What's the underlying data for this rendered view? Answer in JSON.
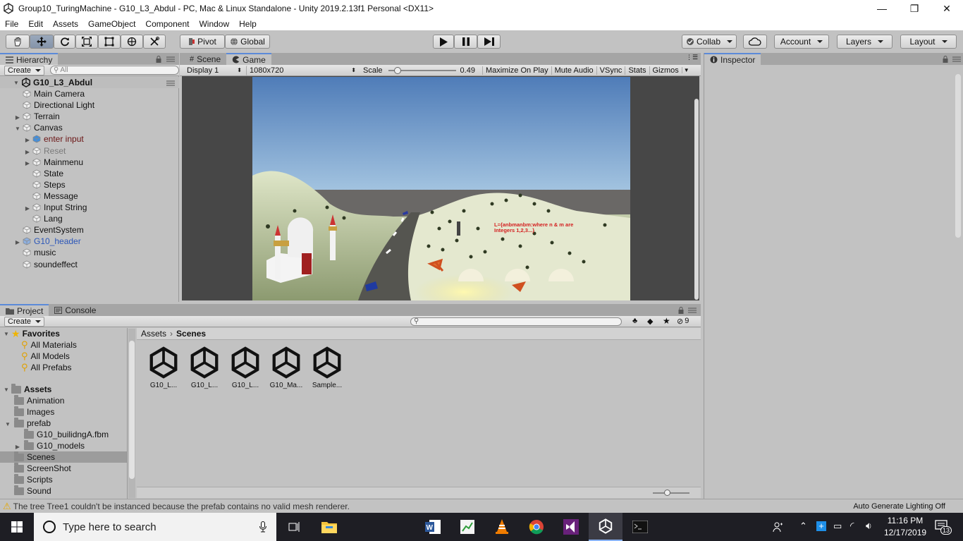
{
  "window": {
    "title": "Group10_TuringMachine - G10_L3_Abdul - PC, Mac & Linux Standalone - Unity 2019.2.13f1 Personal <DX11>",
    "minimize": "—",
    "maximize": "❐",
    "close": "✕"
  },
  "menu": [
    "File",
    "Edit",
    "Assets",
    "GameObject",
    "Component",
    "Window",
    "Help"
  ],
  "toolbar": {
    "pivot": "Pivot",
    "global": "Global",
    "collab": "Collab",
    "account": "Account",
    "layers": "Layers",
    "layout": "Layout"
  },
  "hierarchy": {
    "tab": "Hierarchy",
    "create": "Create",
    "search_placeholder": "All",
    "scene": "G10_L3_Abdul",
    "items": [
      {
        "label": "Main Camera",
        "depth": 1,
        "expand": ""
      },
      {
        "label": "Directional Light",
        "depth": 1,
        "expand": ""
      },
      {
        "label": "Terrain",
        "depth": 1,
        "expand": "▶"
      },
      {
        "label": "Canvas",
        "depth": 1,
        "expand": "▼"
      },
      {
        "label": "enter input",
        "depth": 2,
        "expand": "▶"
      },
      {
        "label": "Reset",
        "depth": 2,
        "expand": "▶"
      },
      {
        "label": "Mainmenu",
        "depth": 2,
        "expand": "▶"
      },
      {
        "label": "State",
        "depth": 2,
        "expand": ""
      },
      {
        "label": "Steps",
        "depth": 2,
        "expand": ""
      },
      {
        "label": "Message",
        "depth": 2,
        "expand": ""
      },
      {
        "label": "Input String",
        "depth": 2,
        "expand": "▶"
      },
      {
        "label": "Lang",
        "depth": 2,
        "expand": ""
      },
      {
        "label": "EventSystem",
        "depth": 1,
        "expand": ""
      },
      {
        "label": "G10_header",
        "depth": 1,
        "expand": "▶"
      },
      {
        "label": "music",
        "depth": 1,
        "expand": ""
      },
      {
        "label": "soundeffect",
        "depth": 1,
        "expand": ""
      }
    ]
  },
  "views": {
    "scene_tab": "Scene",
    "game_tab": "Game",
    "display": "Display 1",
    "resolution": "1080x720",
    "scale_label": "Scale",
    "scale_value": "0.49",
    "scale_fraction": 0.1,
    "maximize": "Maximize On Play",
    "mute": "Mute Audio",
    "vsync": "VSync",
    "stats": "Stats",
    "gizmos": "Gizmos",
    "game_text_line1": "L={anbmanbm:where n & m are",
    "game_text_line2": "Integers 1,2,3...}"
  },
  "inspector": {
    "tab": "Inspector"
  },
  "project": {
    "project_tab": "Project",
    "console_tab": "Console",
    "create": "Create",
    "hidden_count": "9",
    "favorites": {
      "title": "Favorites",
      "items": [
        "All Materials",
        "All Models",
        "All Prefabs"
      ]
    },
    "assets": {
      "title": "Assets",
      "items": [
        {
          "label": "Animation",
          "depth": 1
        },
        {
          "label": "Images",
          "depth": 1
        },
        {
          "label": "prefab",
          "depth": 1
        },
        {
          "label": "G10_builidngA.fbm",
          "depth": 2
        },
        {
          "label": "G10_models",
          "depth": 2
        },
        {
          "label": "Scenes",
          "depth": 1
        },
        {
          "label": "ScreenShot",
          "depth": 1
        },
        {
          "label": "Scripts",
          "depth": 1
        },
        {
          "label": "Sound",
          "depth": 1
        }
      ]
    },
    "breadcrumb": [
      "Assets",
      "Scenes"
    ],
    "files": [
      "G10_L...",
      "G10_L...",
      "G10_L...",
      "G10_Ma...",
      "Sample..."
    ]
  },
  "status": {
    "message": "The tree Tree1 couldn't be instanced because the prefab contains no valid mesh renderer.",
    "right": "Auto Generate Lighting Off"
  },
  "taskbar": {
    "search_placeholder": "Type here to search",
    "time": "11:16 PM",
    "date": "12/17/2019",
    "notifications": "13"
  }
}
